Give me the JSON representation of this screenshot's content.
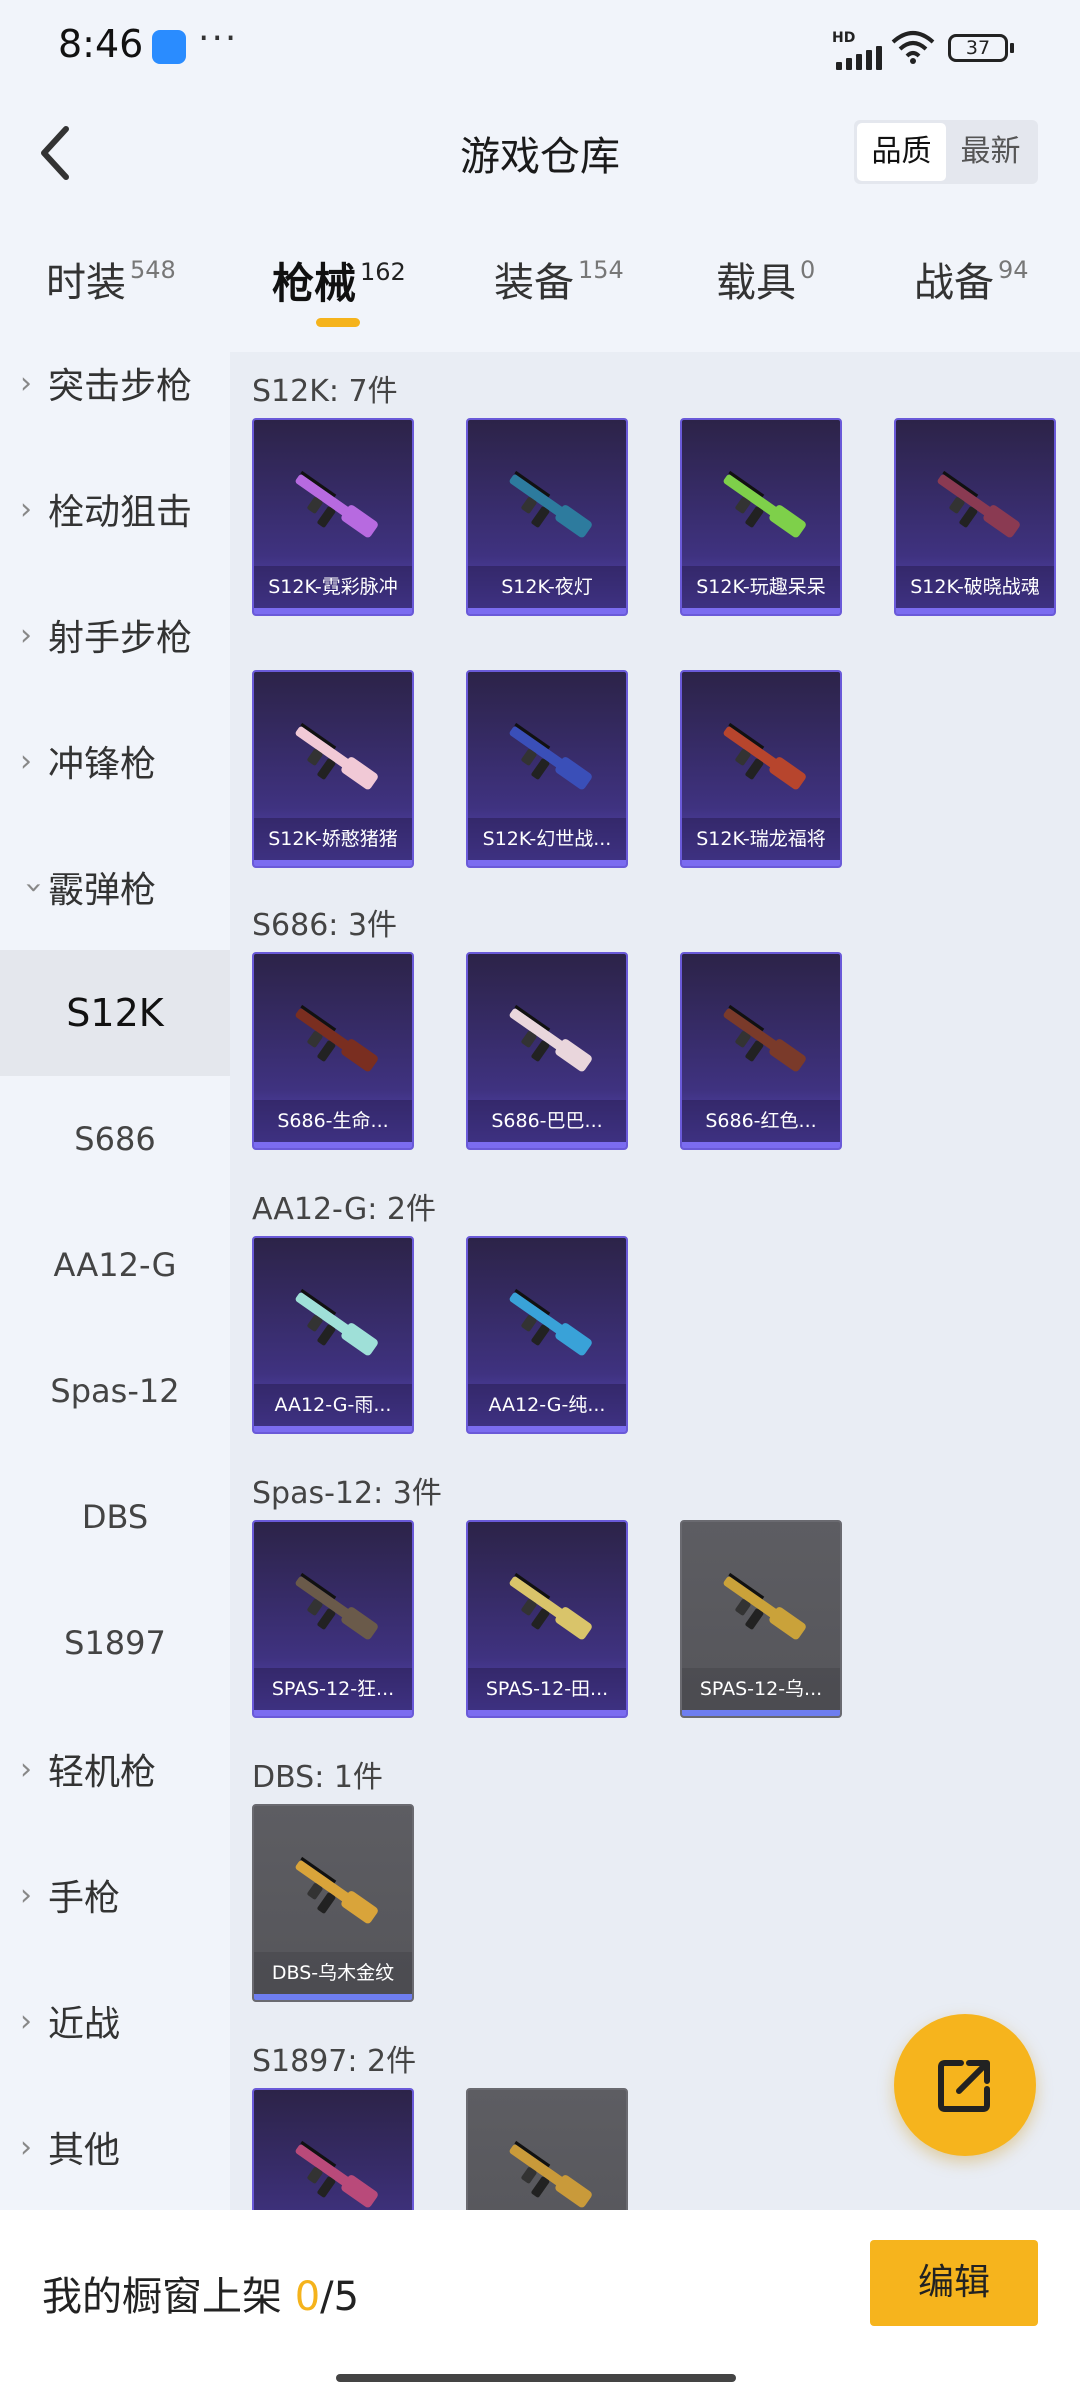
{
  "status": {
    "time": "8:46",
    "dots": "···",
    "network": "HD",
    "battery": "37"
  },
  "header": {
    "title": "游戏仓库",
    "sort_options": [
      "品质",
      "最新"
    ]
  },
  "tabs": [
    {
      "label": "时装",
      "count": "548"
    },
    {
      "label": "枪械",
      "count": "162"
    },
    {
      "label": "装备",
      "count": "154"
    },
    {
      "label": "载具",
      "count": "0"
    },
    {
      "label": "战备",
      "count": "94"
    }
  ],
  "sidebar": {
    "categories": [
      "突击步枪",
      "栓动狙击",
      "射手步枪",
      "冲锋枪",
      "霰弹枪",
      "轻机枪",
      "手枪",
      "近战",
      "其他"
    ],
    "sub": [
      "S12K",
      "S686",
      "AA12-G",
      "Spas-12",
      "DBS",
      "S1897"
    ]
  },
  "groups": [
    {
      "title": "S12K: 7件",
      "items": [
        "S12K-霓彩脉冲",
        "S12K-夜灯",
        "S12K-玩趣呆呆",
        "S12K-破晓战魂",
        "S12K-娇憨猪猪",
        "S12K-幻世战...",
        "S12K-瑞龙福将"
      ]
    },
    {
      "title": "S686: 3件",
      "items": [
        "S686-生命...",
        "S686-巴巴...",
        "S686-红色..."
      ]
    },
    {
      "title": "AA12-G: 2件",
      "items": [
        "AA12-G-雨...",
        "AA12-G-纯..."
      ]
    },
    {
      "title": "Spas-12: 3件",
      "items": [
        "SPAS-12-狂...",
        "SPAS-12-田...",
        "SPAS-12-乌..."
      ]
    },
    {
      "title": "DBS: 1件",
      "items": [
        "DBS-乌木金纹"
      ]
    },
    {
      "title": "S1897: 2件",
      "items": [
        "",
        ""
      ]
    }
  ],
  "colors": {
    "accent": "#f5b31c",
    "item_purple": "#3f3280",
    "item_grey": "#5d5d62"
  },
  "bottom": {
    "shelf_label": "我的橱窗上架 ",
    "shelf_current": "0",
    "shelf_total": "/5",
    "edit_label": "编辑"
  }
}
